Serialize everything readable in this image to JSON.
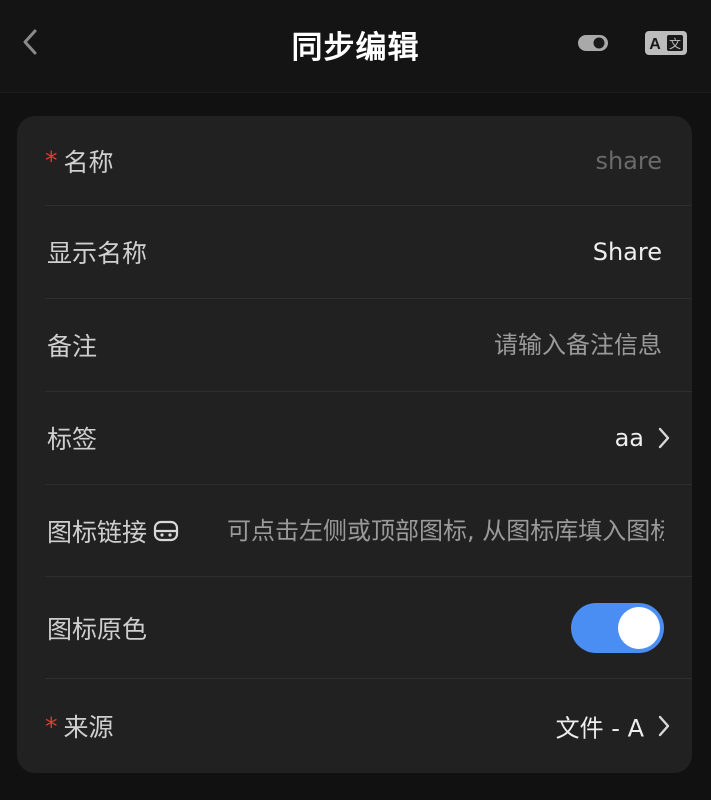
{
  "nav": {
    "title": "同步编辑",
    "back_icon": "chevron-left-icon",
    "toggle_icon": "toggle-icon",
    "translate_icon": "translate-icon"
  },
  "form": {
    "name": {
      "label": "名称",
      "required_mark": "*",
      "value": "",
      "placeholder": "share"
    },
    "display_name": {
      "label": "显示名称",
      "value": "Share"
    },
    "note": {
      "label": "备注",
      "value": "",
      "placeholder": "请输入备注信息"
    },
    "tags": {
      "label": "标签",
      "value": "aa"
    },
    "icon_link": {
      "label": "图标链接",
      "value": "",
      "placeholder": "可点击左侧或顶部图标, 从图标库填入图标链接",
      "icon": "icon-library-icon"
    },
    "icon_original_color": {
      "label": "图标原色",
      "enabled": true
    },
    "source": {
      "label": "来源",
      "required_mark": "*",
      "value": "文件 - A"
    }
  },
  "colors": {
    "accent": "#4a8ef4",
    "required": "#e53935",
    "card_bg": "#212121",
    "page_bg": "#111111"
  }
}
